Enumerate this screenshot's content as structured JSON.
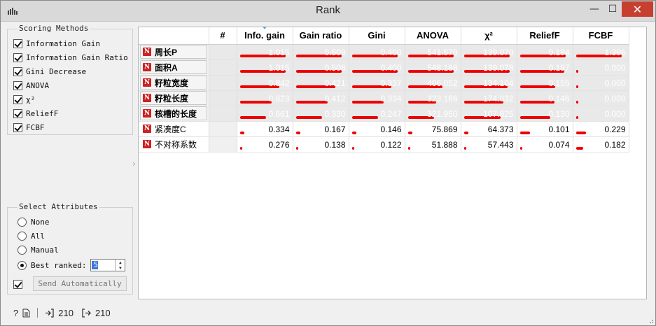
{
  "window": {
    "title": "Rank",
    "minimize": "—",
    "maximize": "☐",
    "close": "✕"
  },
  "scoring": {
    "title": "Scoring Methods",
    "methods": [
      {
        "label": "Information Gain",
        "checked": true
      },
      {
        "label": "Information Gain Ratio",
        "checked": true
      },
      {
        "label": "Gini Decrease",
        "checked": true
      },
      {
        "label": "ANOVA",
        "checked": true
      },
      {
        "label": "χ²",
        "checked": true
      },
      {
        "label": "ReliefF",
        "checked": true
      },
      {
        "label": "FCBF",
        "checked": true
      }
    ]
  },
  "select": {
    "title": "Select Attributes",
    "options": [
      {
        "label": "None",
        "checked": false
      },
      {
        "label": "All",
        "checked": false
      },
      {
        "label": "Manual",
        "checked": false
      },
      {
        "label": "Best ranked:",
        "checked": true
      }
    ],
    "best_value": "5",
    "auto_send_checked": true,
    "send_label": "Send Automatically"
  },
  "status": {
    "input_count": "210",
    "output_count": "210"
  },
  "table": {
    "headers": [
      "#",
      "Info. gain",
      "Gain ratio",
      "Gini",
      "ANOVA",
      "χ²",
      "ReliefF",
      "FCBF"
    ],
    "rows": [
      {
        "name": "周长P",
        "selected": true,
        "values": [
          "1.015",
          "0.509",
          "0.400",
          "541.579",
          "139.070",
          "0.194",
          "1.396"
        ],
        "fill": [
          0.9,
          0.9,
          0.9,
          0.9,
          0.9,
          0.9,
          0.9
        ]
      },
      {
        "name": "面积A",
        "selected": true,
        "values": [
          "1.015",
          "0.508",
          "0.400",
          "548.188",
          "139.078",
          "0.197",
          "0.000"
        ],
        "fill": [
          0.9,
          0.9,
          0.9,
          0.9,
          0.9,
          0.88,
          0.03
        ]
      },
      {
        "name": "籽粒宽度",
        "selected": true,
        "values": [
          "0.842",
          "0.421",
          "0.337",
          "406.052",
          "134.104",
          "0.155",
          "0.000"
        ],
        "fill": [
          0.78,
          0.78,
          0.78,
          0.68,
          0.86,
          0.7,
          0.03
        ]
      },
      {
        "name": "籽粒长度",
        "selected": true,
        "values": [
          "0.823",
          "0.412",
          "0.334",
          "323.186",
          "174.032",
          "0.146",
          "0.000"
        ],
        "fill": [
          0.62,
          0.62,
          0.62,
          0.55,
          0.78,
          0.68,
          0.03
        ]
      },
      {
        "name": "核槽的长度",
        "selected": true,
        "values": [
          "0.661",
          "0.330",
          "0.247",
          "321.950",
          "107.825",
          "0.130",
          "0.000"
        ],
        "fill": [
          0.52,
          0.52,
          0.52,
          0.52,
          0.72,
          0.6,
          0.03
        ]
      },
      {
        "name": "紧凑度C",
        "selected": false,
        "values": [
          "0.334",
          "0.167",
          "0.146",
          "75.869",
          "64.373",
          "0.101",
          "0.229"
        ],
        "fill": [
          0.08,
          0.08,
          0.08,
          0.08,
          0.08,
          0.2,
          0.2
        ]
      },
      {
        "name": "不对称系数",
        "selected": false,
        "values": [
          "0.276",
          "0.138",
          "0.122",
          "51.888",
          "57.443",
          "0.074",
          "0.182"
        ],
        "fill": [
          0.03,
          0.03,
          0.03,
          0.03,
          0.03,
          0.03,
          0.14
        ]
      }
    ]
  },
  "colors": {
    "bar": "#ee0000",
    "badge": "#cc2222",
    "close_button": "#c7402f"
  }
}
